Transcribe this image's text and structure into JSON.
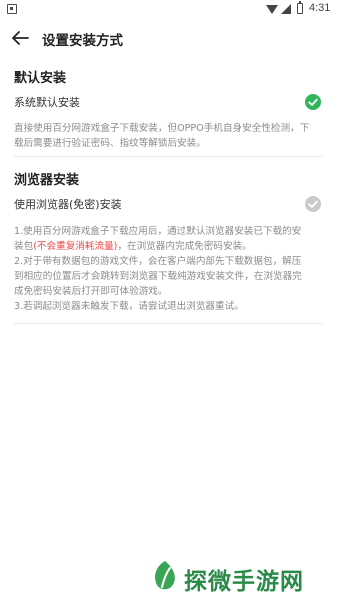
{
  "status_bar": {
    "time": "4:31"
  },
  "header": {
    "title": "设置安装方式"
  },
  "system_section": {
    "title": "默认安装",
    "option_label": "系统默认安装",
    "selected": true,
    "desc": "直接使用百分网游戏盒子下载安装，但OPPO手机自身安全性检测，下载后需要进行验证密码、指纹等解锁后安装。"
  },
  "browser_section": {
    "title": "浏览器安装",
    "option_label": "使用浏览器(免密)安装",
    "selected": false,
    "note1_a": "1.使用百分网游戏盒子下载应用后，通过默认浏览器安装已下载的安装包",
    "note1_red": "(不会重复消耗流量)",
    "note1_b": "，在浏览器内完成免密码安装。",
    "note2": "2.对于带有数据包的游戏文件，会在客户端内部先下载数据包，解压到相应的位置后才会跳转到浏览器下载纯游戏安装文件，在浏览器完成免密码安装后打开即可体验游戏。",
    "note3": "3.若调起浏览器未触发下载，请尝试退出浏览器重试。"
  },
  "watermark": {
    "text": "探微手游网"
  },
  "colors": {
    "accent_green": "#2eb65a",
    "highlight_red": "#e84a4a",
    "muted_text": "#8c8c8c"
  },
  "icons": [
    "back-arrow-icon",
    "check-circle-icon",
    "wifi-icon",
    "signal-icon",
    "battery-icon"
  ]
}
